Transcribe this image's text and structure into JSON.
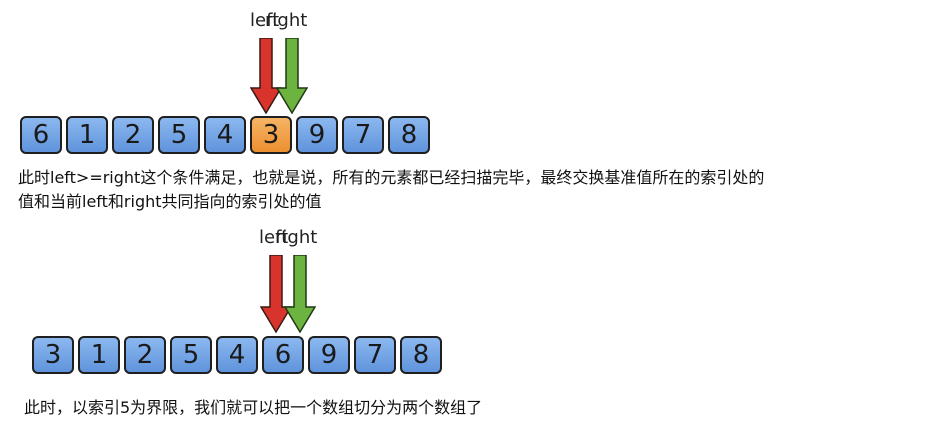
{
  "colors": {
    "cell_blue": "#6f9fe3",
    "cell_highlight": "#f0a14a",
    "left_arrow": "#d9342b",
    "right_arrow": "#6cb33f"
  },
  "pointer_labels": {
    "left": "left",
    "right": "right"
  },
  "step1": {
    "array": [
      "6",
      "1",
      "2",
      "5",
      "4",
      "3",
      "9",
      "7",
      "8"
    ],
    "highlight_index": 5,
    "caption_lines": [
      "此时left>=right这个条件满足，也就是说，所有的元素都已经扫描完毕，最终交换基准值所在的索引处的",
      "值和当前left和right共同指向的索引处的值"
    ]
  },
  "step2": {
    "array": [
      "3",
      "1",
      "2",
      "5",
      "4",
      "6",
      "9",
      "7",
      "8"
    ],
    "highlight_index": -1,
    "caption": "此时，以索引5为界限，我们就可以把一个数组切分为两个数组了"
  }
}
